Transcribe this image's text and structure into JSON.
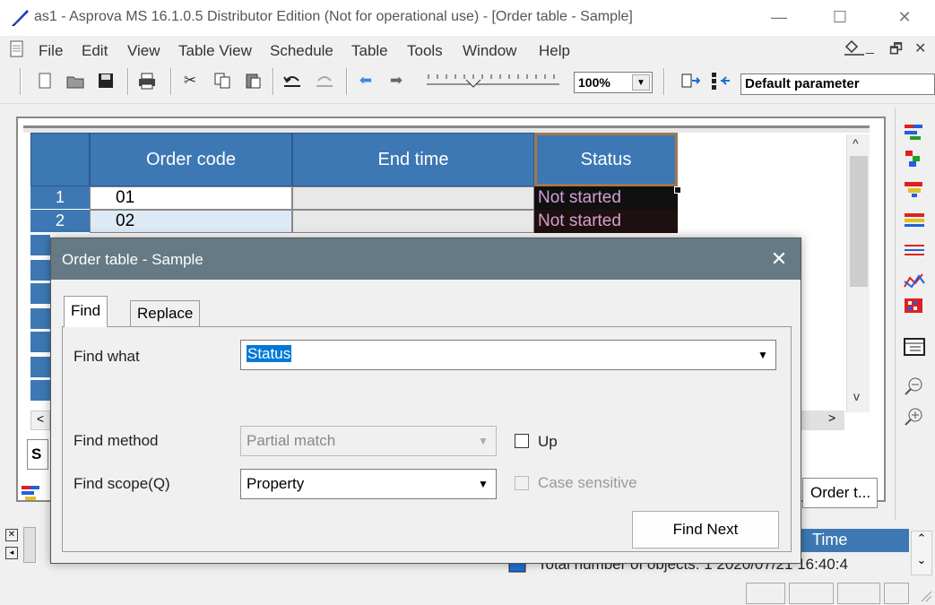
{
  "window": {
    "title": "as1 - Asprova MS 16.1.0.5 Distributor Edition (Not for operational use)   - [Order table - Sample]",
    "minimize": "—",
    "maximize": "☐",
    "close": "✕"
  },
  "menu": {
    "items": [
      "File",
      "Edit",
      "View",
      "Table View",
      "Schedule",
      "Table",
      "Tools",
      "Window",
      "Help"
    ],
    "mdi_minimize": "_",
    "mdi_restore": "🗗",
    "mdi_close": "✕"
  },
  "toolbar": {
    "zoom_value": "100%",
    "parameter_value": "Default parameter"
  },
  "grid": {
    "columns": [
      "Order code",
      "End time",
      "Status"
    ],
    "rows": [
      {
        "num": "1",
        "order_code": "01",
        "end_time": "",
        "status": "Not started"
      },
      {
        "num": "2",
        "order_code": "02",
        "end_time": "",
        "status": "Not started"
      }
    ],
    "sheet_tab_partial": "S",
    "scroll_up": "^",
    "scroll_down": "v",
    "scroll_left": "<",
    "scroll_right": ">"
  },
  "bottom": {
    "order_tab_label": "Order t...",
    "time_header": "Time",
    "status_line": "Total number of objects: 1 2020/07/21 16:40:4"
  },
  "dialog": {
    "title": "Order table - Sample",
    "close": "✕",
    "tabs": {
      "find": "Find",
      "replace": "Replace"
    },
    "find_what_label": "Find what",
    "find_what_value": "Status",
    "find_method_label": "Find method",
    "find_method_value": "Partial match",
    "find_scope_label": "Find scope(Q)",
    "find_scope_value": "Property",
    "up_label": "Up",
    "case_sensitive_label": "Case sensitive",
    "find_next_label": "Find Next"
  }
}
